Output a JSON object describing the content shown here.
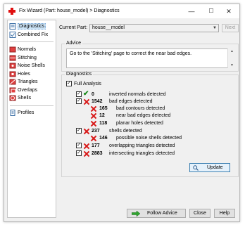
{
  "window": {
    "title": "Fix Wizard (Part: house_model) > Diagnostics",
    "minimize": "—",
    "maximize": "☐",
    "close": "✕"
  },
  "sidebar": {
    "items": [
      {
        "label": "Diagnostics",
        "icon": "diagnostics-icon"
      },
      {
        "label": "Combined Fix",
        "icon": "combined-fix-icon"
      },
      {
        "label": "Normals",
        "icon": "normals-icon"
      },
      {
        "label": "Stitching",
        "icon": "stitching-icon"
      },
      {
        "label": "Noise Shells",
        "icon": "noise-shells-icon"
      },
      {
        "label": "Holes",
        "icon": "holes-icon"
      },
      {
        "label": "Triangles",
        "icon": "triangles-icon"
      },
      {
        "label": "Overlaps",
        "icon": "overlaps-icon"
      },
      {
        "label": "Shells",
        "icon": "shells-icon"
      },
      {
        "label": "Profiles",
        "icon": "profiles-icon"
      }
    ]
  },
  "header": {
    "current_part_label": "Current Part:",
    "current_part_value": "house__model",
    "next_label": "Next"
  },
  "advice": {
    "title": "Advice",
    "text": "Go to the 'Stitching' page to correct the near bad edges."
  },
  "diagnostics": {
    "title": "Diagnostics",
    "full_analysis_label": "Full Analysis",
    "rows": [
      {
        "count": "0",
        "label": "inverted normals detected",
        "status": "ok"
      },
      {
        "count": "1542",
        "label": "bad edges detected",
        "status": "error"
      },
      {
        "count": "165",
        "label": "bad contours detected",
        "status": "error"
      },
      {
        "count": "12",
        "label": "near bad edges detected",
        "status": "error"
      },
      {
        "count": "118",
        "label": "planar holes detected",
        "status": "error"
      },
      {
        "count": "237",
        "label": "shells detected",
        "status": "error"
      },
      {
        "count": "146",
        "label": "possible noise shells detected",
        "status": "error"
      },
      {
        "count": "177",
        "label": "overlapping triangles detected",
        "status": "error"
      },
      {
        "count": "2883",
        "label": "intersecting triangles detected",
        "status": "error"
      }
    ],
    "update_label": "Update"
  },
  "footer": {
    "follow_advice_label": "Follow Advice",
    "close_label": "Close",
    "help_label": "Help"
  },
  "colors": {
    "error": "#d81818",
    "ok": "#1a8a1a",
    "selection": "#cce4f7"
  }
}
